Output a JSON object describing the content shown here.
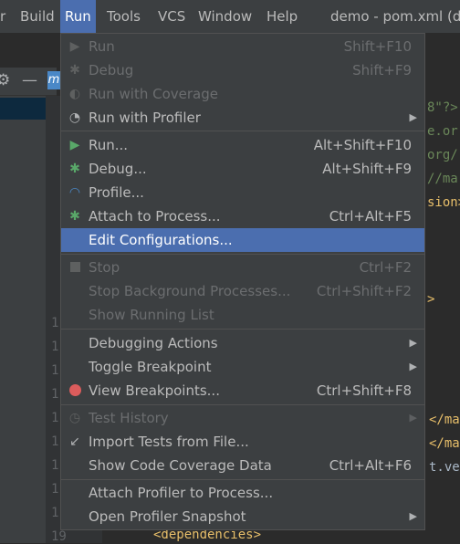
{
  "menubar": {
    "items": [
      {
        "label": "r"
      },
      {
        "label": "Build"
      },
      {
        "label": "Run"
      },
      {
        "label": "Tools"
      },
      {
        "label": "VCS"
      },
      {
        "label": "Window"
      },
      {
        "label": "Help"
      }
    ],
    "window_title": "demo - pom.xml (de"
  },
  "gutter": {
    "line_numbers": [
      "1",
      "1",
      "1",
      "1",
      "1",
      "1",
      "1",
      "1",
      "1",
      "19"
    ]
  },
  "editor": {
    "lines": [
      {
        "text": "8\"?>"
      },
      {
        "text": "e.or"
      },
      {
        "text": "org/"
      },
      {
        "text": "//ma"
      },
      {
        "text": "sion>"
      },
      {
        "text": ">"
      },
      {
        "text": "</ma"
      },
      {
        "text": "</ma"
      },
      {
        "text": "t.ve"
      }
    ],
    "bottom_line": "<dependencies>"
  },
  "run_menu": {
    "items": [
      {
        "label": "Run",
        "shortcut": "Shift+F10",
        "icon": "play-icon",
        "disabled": true
      },
      {
        "label": "Debug",
        "shortcut": "Shift+F9",
        "icon": "bug-icon",
        "disabled": true
      },
      {
        "label": "Run with Coverage",
        "shortcut": "",
        "icon": "coverage-icon",
        "disabled": true
      },
      {
        "label": "Run with Profiler",
        "shortcut": "",
        "icon": "profiler-icon",
        "submenu": true
      },
      {
        "label": "Run...",
        "shortcut": "Alt+Shift+F10",
        "icon": "play-icon"
      },
      {
        "label": "Debug...",
        "shortcut": "Alt+Shift+F9",
        "icon": "bug-icon"
      },
      {
        "label": "Profile...",
        "shortcut": "",
        "icon": "gauge-icon"
      },
      {
        "label": "Attach to Process...",
        "shortcut": "Ctrl+Alt+F5",
        "icon": "attach-bug-icon"
      },
      {
        "label": "Edit Configurations...",
        "shortcut": "",
        "icon": "",
        "highlighted": true
      },
      {
        "label": "Stop",
        "shortcut": "Ctrl+F2",
        "icon": "stop-icon",
        "disabled": true
      },
      {
        "label": "Stop Background Processes...",
        "shortcut": "Ctrl+Shift+F2",
        "icon": "",
        "disabled": true
      },
      {
        "label": "Show Running List",
        "shortcut": "",
        "icon": "",
        "disabled": true
      },
      {
        "label": "Debugging Actions",
        "shortcut": "",
        "icon": "",
        "submenu": true
      },
      {
        "label": "Toggle Breakpoint",
        "shortcut": "",
        "icon": "",
        "submenu": true
      },
      {
        "label": "View Breakpoints...",
        "shortcut": "Ctrl+Shift+F8",
        "icon": "breakpoints-icon"
      },
      {
        "label": "Test History",
        "shortcut": "",
        "icon": "clock-icon",
        "disabled": true,
        "submenu": true
      },
      {
        "label": "Import Tests from File...",
        "shortcut": "",
        "icon": "import-icon"
      },
      {
        "label": "Show Code Coverage Data",
        "shortcut": "Ctrl+Alt+F6",
        "icon": ""
      },
      {
        "label": "Attach Profiler to Process...",
        "shortcut": "",
        "icon": ""
      },
      {
        "label": "Open Profiler Snapshot",
        "shortcut": "",
        "icon": "",
        "submenu": true
      }
    ]
  },
  "colors": {
    "highlight": "#4b6eaf",
    "play_green": "#59a869",
    "breakpoint_red": "#db5c5c",
    "xml_tag": "#e8bf6a",
    "xml_string": "#6a8759"
  }
}
